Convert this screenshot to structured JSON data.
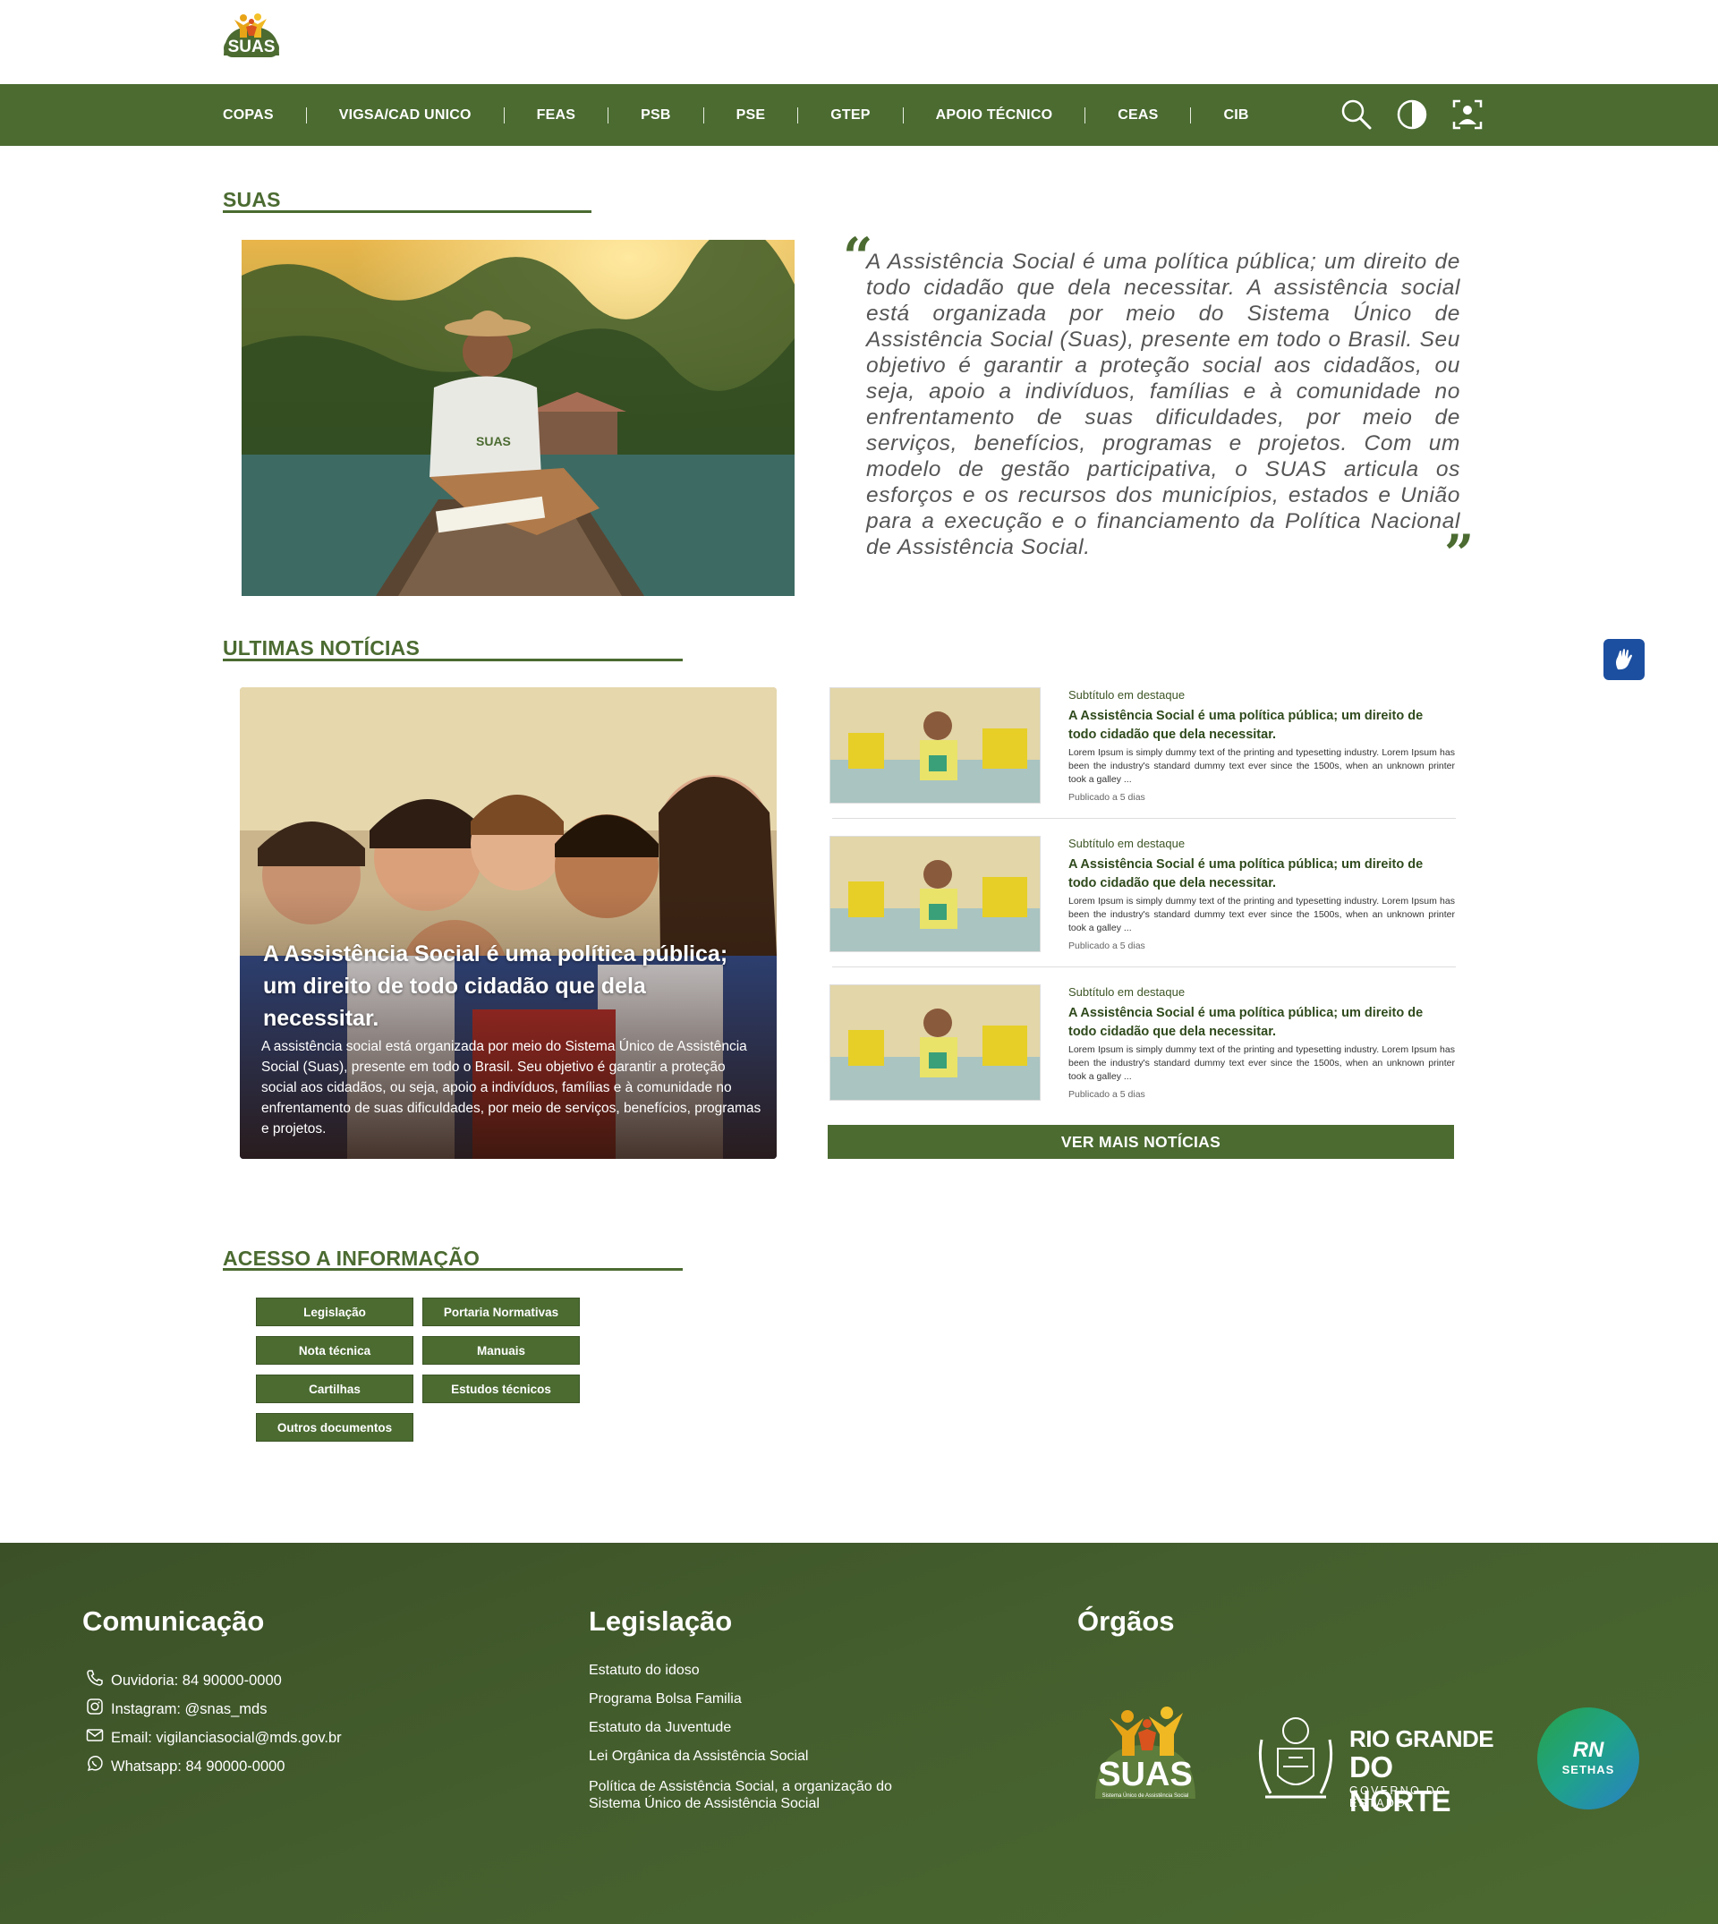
{
  "header": {
    "logo_text": "SUAS",
    "nav": [
      "COPAS",
      "VIGSA/CAD UNICO",
      "FEAS",
      "PSB",
      "PSE",
      "GTEP",
      "APOIO TÉCNICO",
      "CEAS",
      "CIB"
    ],
    "tools": [
      "search-icon",
      "contrast-icon",
      "accessibility-icon"
    ]
  },
  "suas_section": {
    "title": "SUAS",
    "quote_open": "“",
    "quote_close": "”",
    "quote": "A Assistência Social é uma política pública; um direito de todo cidadão que dela necessitar. A assistência social está organizada por meio do Sistema Único de Assistência Social (Suas), presente em todo o Brasil. Seu objetivo é garantir a proteção social aos cidadãos, ou seja, apoio a indivíduos, famílias e à comunidade no enfrentamento de suas dificuldades, por meio de serviços, benefícios, programas e projetos. Com um modelo de gestão participativa, o SUAS articula os esforços e os recursos dos municípios, estados e União para a execução e o financiamento da Política Nacional de Assistência Social."
  },
  "news_section": {
    "title": "ULTIMAS NOTÍCIAS",
    "featured": {
      "title": "A Assistência Social é uma política pública; um direito de todo cidadão que dela necessitar.",
      "description": "A assistência social está organizada por meio do Sistema Único de Assistência Social (Suas), presente em todo o Brasil. Seu objetivo é garantir a proteção social aos cidadãos, ou seja, apoio a indivíduos, famílias e à comunidade no enfrentamento de suas dificuldades, por meio de serviços, benefícios, programas e projetos."
    },
    "items": [
      {
        "subtitle": "Subtítulo em destaque",
        "title": "A Assistência Social é uma política pública; um direito de todo cidadão que dela necessitar.",
        "description": "Lorem Ipsum is simply dummy text of the printing and  typesetting industry. Lorem Ipsum has been the industry's standard dummy text ever since the 1500s, when an unknown printer took a galley ...",
        "date": "Publicado a 5 dias"
      },
      {
        "subtitle": "Subtítulo em destaque",
        "title": "A Assistência Social é uma política pública; um direito de todo cidadão que dela necessitar.",
        "description": "Lorem Ipsum is simply dummy text of the printing and  typesetting industry. Lorem Ipsum has been the industry's standard dummy text ever since the 1500s, when an unknown printer took a galley ...",
        "date": "Publicado a 5 dias"
      },
      {
        "subtitle": "Subtítulo em destaque",
        "title": "A Assistência Social é uma política pública; um direito de todo cidadão que dela necessitar.",
        "description": "Lorem Ipsum is simply dummy text of the printing and  typesetting industry. Lorem Ipsum has been the industry's standard dummy text ever since the 1500s, when an unknown printer took a galley ...",
        "date": "Publicado a 5 dias"
      }
    ],
    "more_button": "VER MAIS NOTÍCIAS"
  },
  "access_section": {
    "title": "ACESSO A INFORMAÇÃO",
    "buttons": [
      "Legislação",
      "Portaria Normativas",
      "Nota técnica",
      "Manuais",
      "Cartilhas",
      "Estudos técnicos",
      "Outros documentos"
    ]
  },
  "footer": {
    "communication": {
      "title": "Comunicação",
      "items": [
        {
          "icon": "phone-icon",
          "text": "Ouvidoria: 84 90000-0000"
        },
        {
          "icon": "instagram-icon",
          "text": "Instagram: @snas_mds"
        },
        {
          "icon": "mail-icon",
          "text": "Email: vigilanciasocial@mds.gov.br"
        },
        {
          "icon": "whatsapp-icon",
          "text": "Whatsapp: 84 90000-0000"
        }
      ]
    },
    "legislation": {
      "title": "Legislação",
      "items": [
        "Estatuto do idoso",
        "Programa Bolsa Familia",
        "Estatuto da Juventude",
        "Lei Orgânica da Assistência Social",
        "Política de Assistência Social, a organização do Sistema Único de Assistência Social"
      ]
    },
    "organs": {
      "title": "Órgãos",
      "suas_logo": "SUAS",
      "suas_caption": "Sistema Único de Assistência Social",
      "rn_line1": "RIO GRANDE",
      "rn_line2": "DO NORTE",
      "rn_line3": "GOVERNO DO ESTADO",
      "sethas_line1": "RN",
      "sethas_line2": "SETHAS"
    }
  },
  "colors": {
    "brand_green": "#4b6b31",
    "footer_green": "#3b5027",
    "vlibras_blue": "#1c4fa0"
  }
}
